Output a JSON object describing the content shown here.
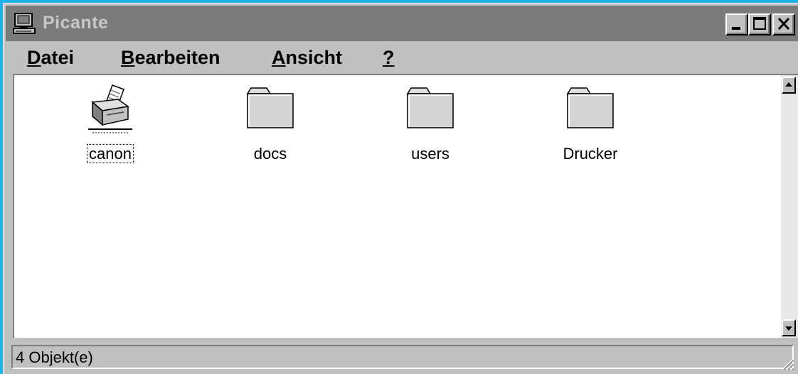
{
  "window": {
    "title": "Picante"
  },
  "menu": {
    "items": [
      {
        "label": "Datei",
        "key": "D",
        "rest": "atei"
      },
      {
        "label": "Bearbeiten",
        "key": "B",
        "rest": "earbeiten"
      },
      {
        "label": "Ansicht",
        "key": "A",
        "rest": "nsicht"
      },
      {
        "label": "?",
        "key": "?",
        "rest": ""
      }
    ]
  },
  "items": [
    {
      "name": "canon",
      "icon": "printer-icon",
      "selected": true
    },
    {
      "name": "docs",
      "icon": "folder-icon",
      "selected": false
    },
    {
      "name": "users",
      "icon": "folder-icon",
      "selected": false
    },
    {
      "name": "Drucker",
      "icon": "folder-icon",
      "selected": false
    }
  ],
  "status": {
    "text": "4 Objekt(e)"
  },
  "colors": {
    "desktop": "#21b3e8",
    "titlebar_inactive": "#7b7b7b",
    "face": "#c0c0c0"
  }
}
